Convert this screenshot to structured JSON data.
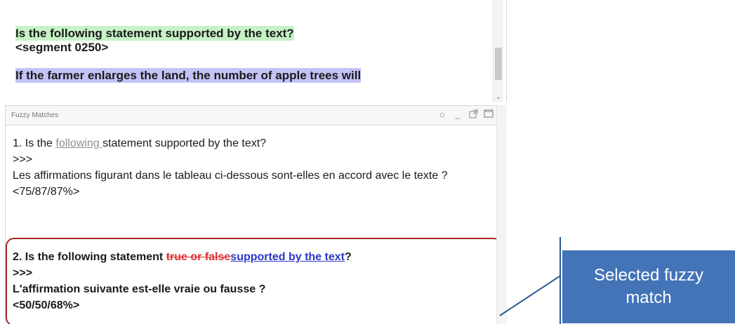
{
  "editor": {
    "question": "Is the following statement supported by the text?",
    "segment_tag": "<segment 0250>",
    "next_sentence": "If the farmer enlarges the land, the number of apple trees will"
  },
  "fuzzy_matches": {
    "title": "Fuzzy Matches",
    "tools": [
      "settings-icon",
      "minimize-icon",
      "undock-icon",
      "maximize-icon"
    ],
    "match1": {
      "prefix": "1. Is the ",
      "inserted": "following ",
      "rest": "statement supported by the text?",
      "arrow": ">>>",
      "translation": "Les affirmations figurant dans le tableau ci-dessous sont-elles en accord avec le texte ?",
      "score": "<75/87/87%>"
    },
    "match2": {
      "prefix": "2. Is the following statement ",
      "deleted": "true or false",
      "inserted": "supported by the text",
      "suffix": "?",
      "arrow": ">>>",
      "translation": "L'affirmation suivante est-elle vraie ou fausse ?",
      "score": "<50/50/68%>"
    }
  },
  "callout": {
    "text": "Selected fuzzy match",
    "color": "#4374b8"
  },
  "colors": {
    "highlight_green": "#c6f2c6",
    "highlight_blue": "#c3c3f7",
    "deleted_red": "#e03030",
    "inserted_blue": "#2a36c8",
    "selection_frame": "#a6262a"
  }
}
